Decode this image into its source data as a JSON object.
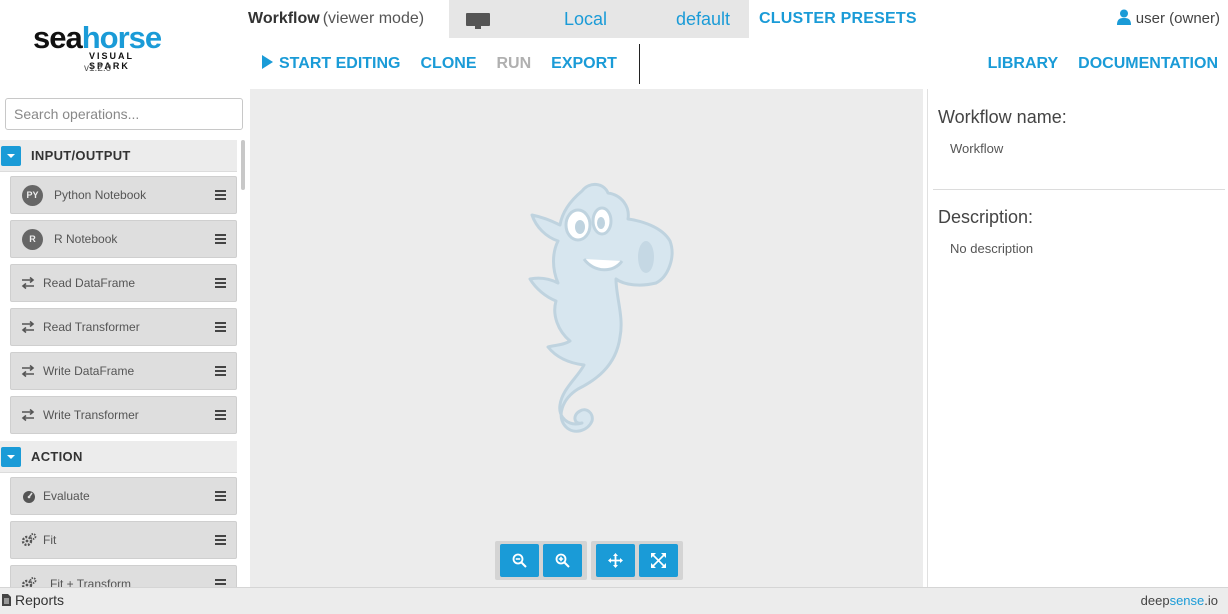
{
  "logo": {
    "part1": "sea",
    "part2": "horse",
    "subtitle": "VISUAL SPARK",
    "version": "v1.2.0"
  },
  "header": {
    "workflow_title": "Workflow",
    "mode": "(viewer mode)",
    "cluster_local": "Local",
    "cluster_default": "default",
    "cluster_presets": "CLUSTER PRESETS",
    "user": "user (owner)"
  },
  "toolbar": {
    "start_editing": "START EDITING",
    "clone": "CLONE",
    "run": "RUN",
    "export": "EXPORT",
    "library": "LIBRARY",
    "documentation": "DOCUMENTATION"
  },
  "sidebar": {
    "search_placeholder": "Search operations...",
    "categories": [
      {
        "label": "INPUT/OUTPUT",
        "items": [
          {
            "label": "Python Notebook",
            "icon": "py-badge",
            "badge": "PY"
          },
          {
            "label": "R Notebook",
            "icon": "r-badge",
            "badge": "R"
          },
          {
            "label": "Read DataFrame",
            "icon": "arrows-icon"
          },
          {
            "label": "Read Transformer",
            "icon": "arrows-icon"
          },
          {
            "label": "Write DataFrame",
            "icon": "arrows-icon"
          },
          {
            "label": "Write Transformer",
            "icon": "arrows-icon"
          }
        ]
      },
      {
        "label": "ACTION",
        "items": [
          {
            "label": "Evaluate",
            "icon": "dashboard-icon"
          },
          {
            "label": "Fit",
            "icon": "gears-icon"
          },
          {
            "label": "Fit + Transform",
            "icon": "gears-icon"
          }
        ]
      }
    ]
  },
  "canvas": {
    "zoom_controls": [
      "zoom-out-icon",
      "zoom-in-icon",
      "move-icon",
      "fit-icon"
    ]
  },
  "right_panel": {
    "name_label": "Workflow name:",
    "name_value": "Workflow",
    "description_label": "Description:",
    "description_value": "No description"
  },
  "footer": {
    "reports": "Reports",
    "brand_part1": "deep",
    "brand_part2": "sense",
    "brand_part3": ".io"
  },
  "colors": {
    "accent": "#1a9bd7",
    "disabled": "#b0b0b0",
    "canvas_bg": "#ececec"
  }
}
